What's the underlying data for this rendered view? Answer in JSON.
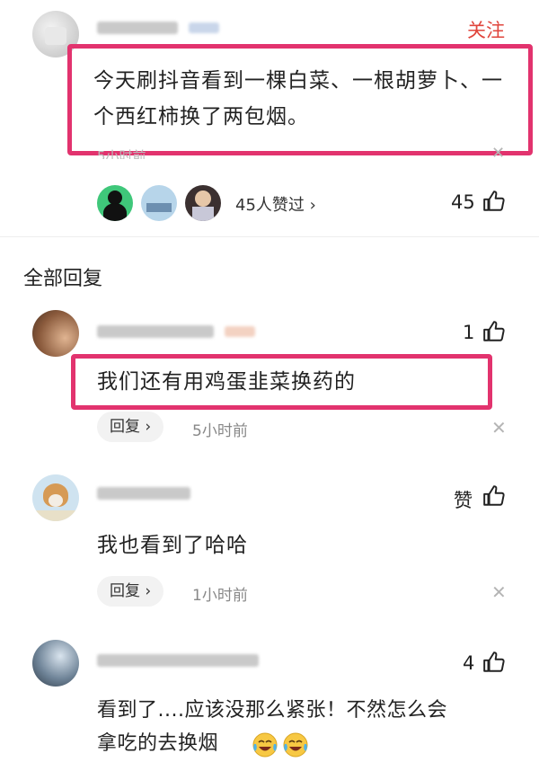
{
  "main_post": {
    "follow_label": "关注",
    "text": "今天刷抖音看到一棵白菜、一根胡萝卜、一个西红柿换了两包烟。",
    "time": "5小时前",
    "likers_label": "45人赞过 ›",
    "like_count": "45"
  },
  "section_title": "全部回复",
  "replies": [
    {
      "text": "我们还有用鸡蛋韭菜换药的",
      "like_count": "1",
      "reply_label": "回复 ›",
      "time": "5小时前"
    },
    {
      "text": "我也看到了哈哈",
      "like_count": "赞",
      "reply_label": "回复 ›",
      "time": "1小时前"
    },
    {
      "text_line1": "看到了....应该没那么紧张！不然怎么会",
      "text_line2": "拿吃的去换烟",
      "like_count": "4"
    }
  ],
  "icons": {
    "close": "close-icon",
    "thumb": "thumbs-up-icon"
  },
  "colors": {
    "highlight": "#e2336e",
    "follow": "#e0453c"
  }
}
